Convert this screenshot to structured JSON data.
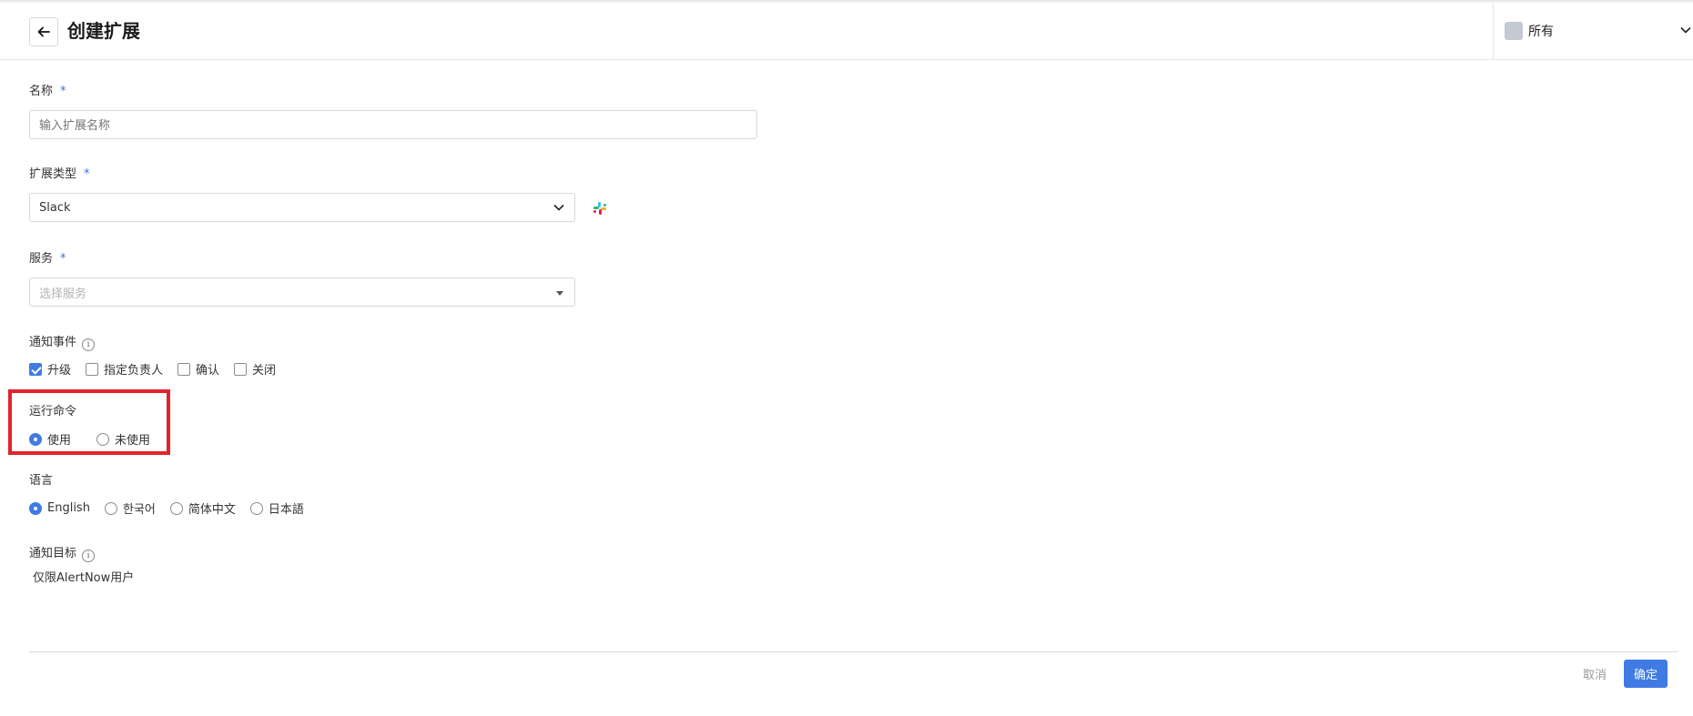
{
  "header": {
    "title": "创建扩展",
    "scope_label": "所有"
  },
  "form": {
    "name": {
      "label": "名称",
      "required_mark": "*",
      "placeholder": "输入扩展名称",
      "value": ""
    },
    "ext_type": {
      "label": "扩展类型",
      "required_mark": "*",
      "value": "Slack",
      "icon": "slack-icon"
    },
    "service": {
      "label": "服务",
      "required_mark": "*",
      "placeholder": "选择服务"
    },
    "notify_events": {
      "label": "通知事件",
      "options": [
        {
          "label": "升级",
          "checked": true
        },
        {
          "label": "指定负责人",
          "checked": false
        },
        {
          "label": "确认",
          "checked": false
        },
        {
          "label": "关闭",
          "checked": false
        }
      ]
    },
    "run_command": {
      "label": "运行命令",
      "options": [
        {
          "label": "使用",
          "selected": true
        },
        {
          "label": "未使用",
          "selected": false
        }
      ]
    },
    "language": {
      "label": "语言",
      "options": [
        {
          "label": "English",
          "selected": true
        },
        {
          "label": "한국어",
          "selected": false
        },
        {
          "label": "简体中文",
          "selected": false
        },
        {
          "label": "日本語",
          "selected": false
        }
      ]
    },
    "notify_target": {
      "label": "通知目标",
      "value": "仅限AlertNow用户"
    }
  },
  "footer": {
    "cancel_label": "取消",
    "ok_label": "确定"
  },
  "colors": {
    "accent": "#3f7be3",
    "highlight": "#e3232c"
  }
}
